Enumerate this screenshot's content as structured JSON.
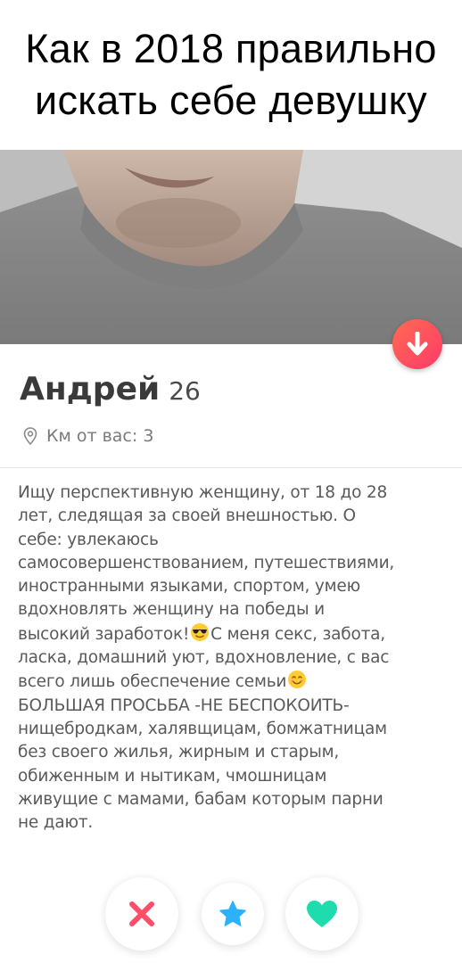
{
  "meme": {
    "title_line1": "Как в 2018 правильно",
    "title_line2": "искать себе девушку"
  },
  "profile": {
    "name": "Андрей",
    "age": "26",
    "distance": "Км от вас: 3"
  },
  "bio": {
    "lines": [
      "Ищу перспективную женщину, от 18 до 28",
      "лет, следящая за своей внешностью. О",
      "себе: увлекаюсь",
      "самосовершенствованием, путешествиями,",
      "иностранными языками, спортом, умею",
      "вдохновлять женщину на победы и",
      "высокий заработок!",
      "С меня секс, забота,",
      "ласка, домашний уют, вдохновление, с вас",
      "всего лишь обеспечение семьи",
      "БОЛЬШАЯ ПРОСЬБА -НЕ БЕСПОКОИТЬ-",
      "нищебродкам, халявщицам, бомжатницам",
      "без своего жилья, жирным и старым,",
      "обиженным и нытикам, чмошницам",
      "живущие с мамами, бабам которым парни",
      "не дают."
    ],
    "emoji_1": "sunglasses-emoji",
    "emoji_2": "smiling-emoji"
  },
  "actions": {
    "nope_icon": "x-icon",
    "superlike_icon": "star-icon",
    "like_icon": "heart-icon"
  },
  "colors": {
    "nope": "#fd5068",
    "superlike": "#2db1ff",
    "like": "#1edcae",
    "down_button": "#fd4e5c"
  }
}
